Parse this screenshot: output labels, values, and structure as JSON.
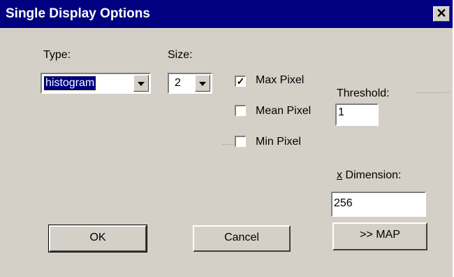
{
  "window": {
    "title": "Single Display Options",
    "close_label": "✕"
  },
  "type": {
    "label": "Type:",
    "value": "histogram"
  },
  "size": {
    "label": "Size:",
    "value": "2"
  },
  "checkboxes": [
    {
      "label": "Max Pixel",
      "checked": true,
      "mark": "✓"
    },
    {
      "label": "Mean Pixel",
      "checked": false,
      "mark": ""
    },
    {
      "label": "Min Pixel",
      "checked": false,
      "mark": ""
    }
  ],
  "threshold": {
    "label": "Threshold:",
    "value": "1"
  },
  "x_dimension": {
    "label_underline": "x",
    "label_rest": " Dimension:",
    "value": "256"
  },
  "buttons": {
    "ok": "OK",
    "cancel": "Cancel",
    "map": ">> MAP"
  }
}
